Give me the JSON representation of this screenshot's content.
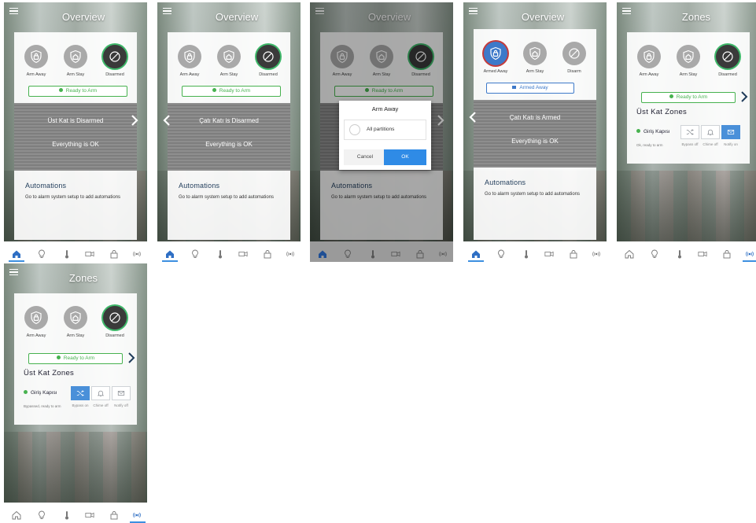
{
  "colors": {
    "accent": "#3d79c9",
    "ready_green": "#47b24f",
    "tab_active": "#2f6fc4"
  },
  "screens": [
    {
      "title": "Overview",
      "modes": [
        "Arm Away",
        "Arm Stay",
        "Disarmed"
      ],
      "status": "Ready to Arm",
      "band": {
        "line1": "Üst Kat is Disarmed",
        "line2": "Everything is OK"
      },
      "automations": {
        "title": "Automations",
        "desc": "Go to alarm system setup to add automations"
      }
    },
    {
      "title": "Overview",
      "modes": [
        "Arm Away",
        "Arm Stay",
        "Disarmed"
      ],
      "status": "Ready to Arm",
      "band": {
        "line1": "Çatı Katı is Disarmed",
        "line2": "Everything is OK"
      },
      "automations": {
        "title": "Automations",
        "desc": "Go to alarm system setup to add automations"
      }
    },
    {
      "title": "Overview",
      "modes": [
        "Arm Away",
        "Arm Stay",
        "Disarmed"
      ],
      "status": "Ready to Arm",
      "automations": {
        "title": "Automations",
        "desc": "Go to alarm system setup to add automations"
      },
      "dialog": {
        "title": "Arm Away",
        "option": "All partitions",
        "cancel": "Cancel",
        "ok": "OK"
      }
    },
    {
      "title": "Overview",
      "modes": [
        "Armed Away",
        "Arm Stay",
        "Disarm"
      ],
      "status": "Armed Away",
      "band": {
        "line1": "Çatı Katı is Armed",
        "line2": "Everything is OK"
      },
      "automations": {
        "title": "Automations",
        "desc": "Go to alarm system setup to add automations"
      }
    },
    {
      "title": "Zones",
      "modes": [
        "Arm Away",
        "Arm Stay",
        "Disarmed"
      ],
      "status": "Ready to Arm",
      "zones_title": "Üst Kat Zones",
      "zone": {
        "name": "Giriş Kapısı",
        "sub": "Ok, ready to arm",
        "btn_labels": [
          "Bypass off",
          "Chime off",
          "Notify on"
        ]
      }
    },
    {
      "title": "Zones",
      "modes": [
        "Arm Away",
        "Arm Stay",
        "Disarmed"
      ],
      "status": "Ready to Arm",
      "zones_title": "Üst Kat Zones",
      "zone": {
        "name": "Giriş Kapısı",
        "sub": "Bypassed, ready to arm",
        "btn_labels": [
          "Bypass on",
          "Chime off",
          "Notify off"
        ]
      }
    }
  ],
  "icons": {
    "menu": "hamburger-icon",
    "shield_lock": "shield-lock-icon",
    "shield_home": "shield-home-icon",
    "disarm": "circle-slash-icon",
    "tabs": [
      "home-icon",
      "bulb-icon",
      "thermometer-icon",
      "camera-icon",
      "lock-icon",
      "security-waves-icon"
    ]
  }
}
